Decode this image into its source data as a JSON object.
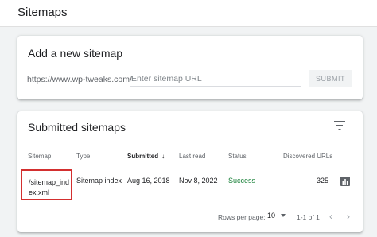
{
  "header": {
    "title": "Sitemaps"
  },
  "add_sitemap": {
    "title": "Add a new sitemap",
    "url_prefix": "https://www.wp-tweaks.com/",
    "input_placeholder": "Enter sitemap URL",
    "input_value": "",
    "submit_label": "SUBMIT"
  },
  "submitted": {
    "title": "Submitted sitemaps",
    "filter_icon": "filter-icon",
    "columns": {
      "sitemap": "Sitemap",
      "type": "Type",
      "submitted": "Submitted",
      "last_read": "Last read",
      "status": "Status",
      "discovered_urls": "Discovered URLs"
    },
    "sort_icon": "arrow-down-icon",
    "rows": [
      {
        "sitemap_line1": "/sitemap_ind",
        "sitemap_line2": "ex.xml",
        "type": "Sitemap index",
        "submitted": "Aug 16, 2018",
        "last_read": "Nov 8, 2022",
        "status": "Success",
        "discovered_urls": "325",
        "action_icon": "bar-chart-icon"
      }
    ],
    "pagination": {
      "rows_per_page_label": "Rows per page:",
      "rows_per_page_value": "10",
      "range": "1-1 of 1"
    }
  },
  "colors": {
    "success": "#188038",
    "highlight_border": "#d32f2f",
    "background": "#f1f3f4"
  }
}
